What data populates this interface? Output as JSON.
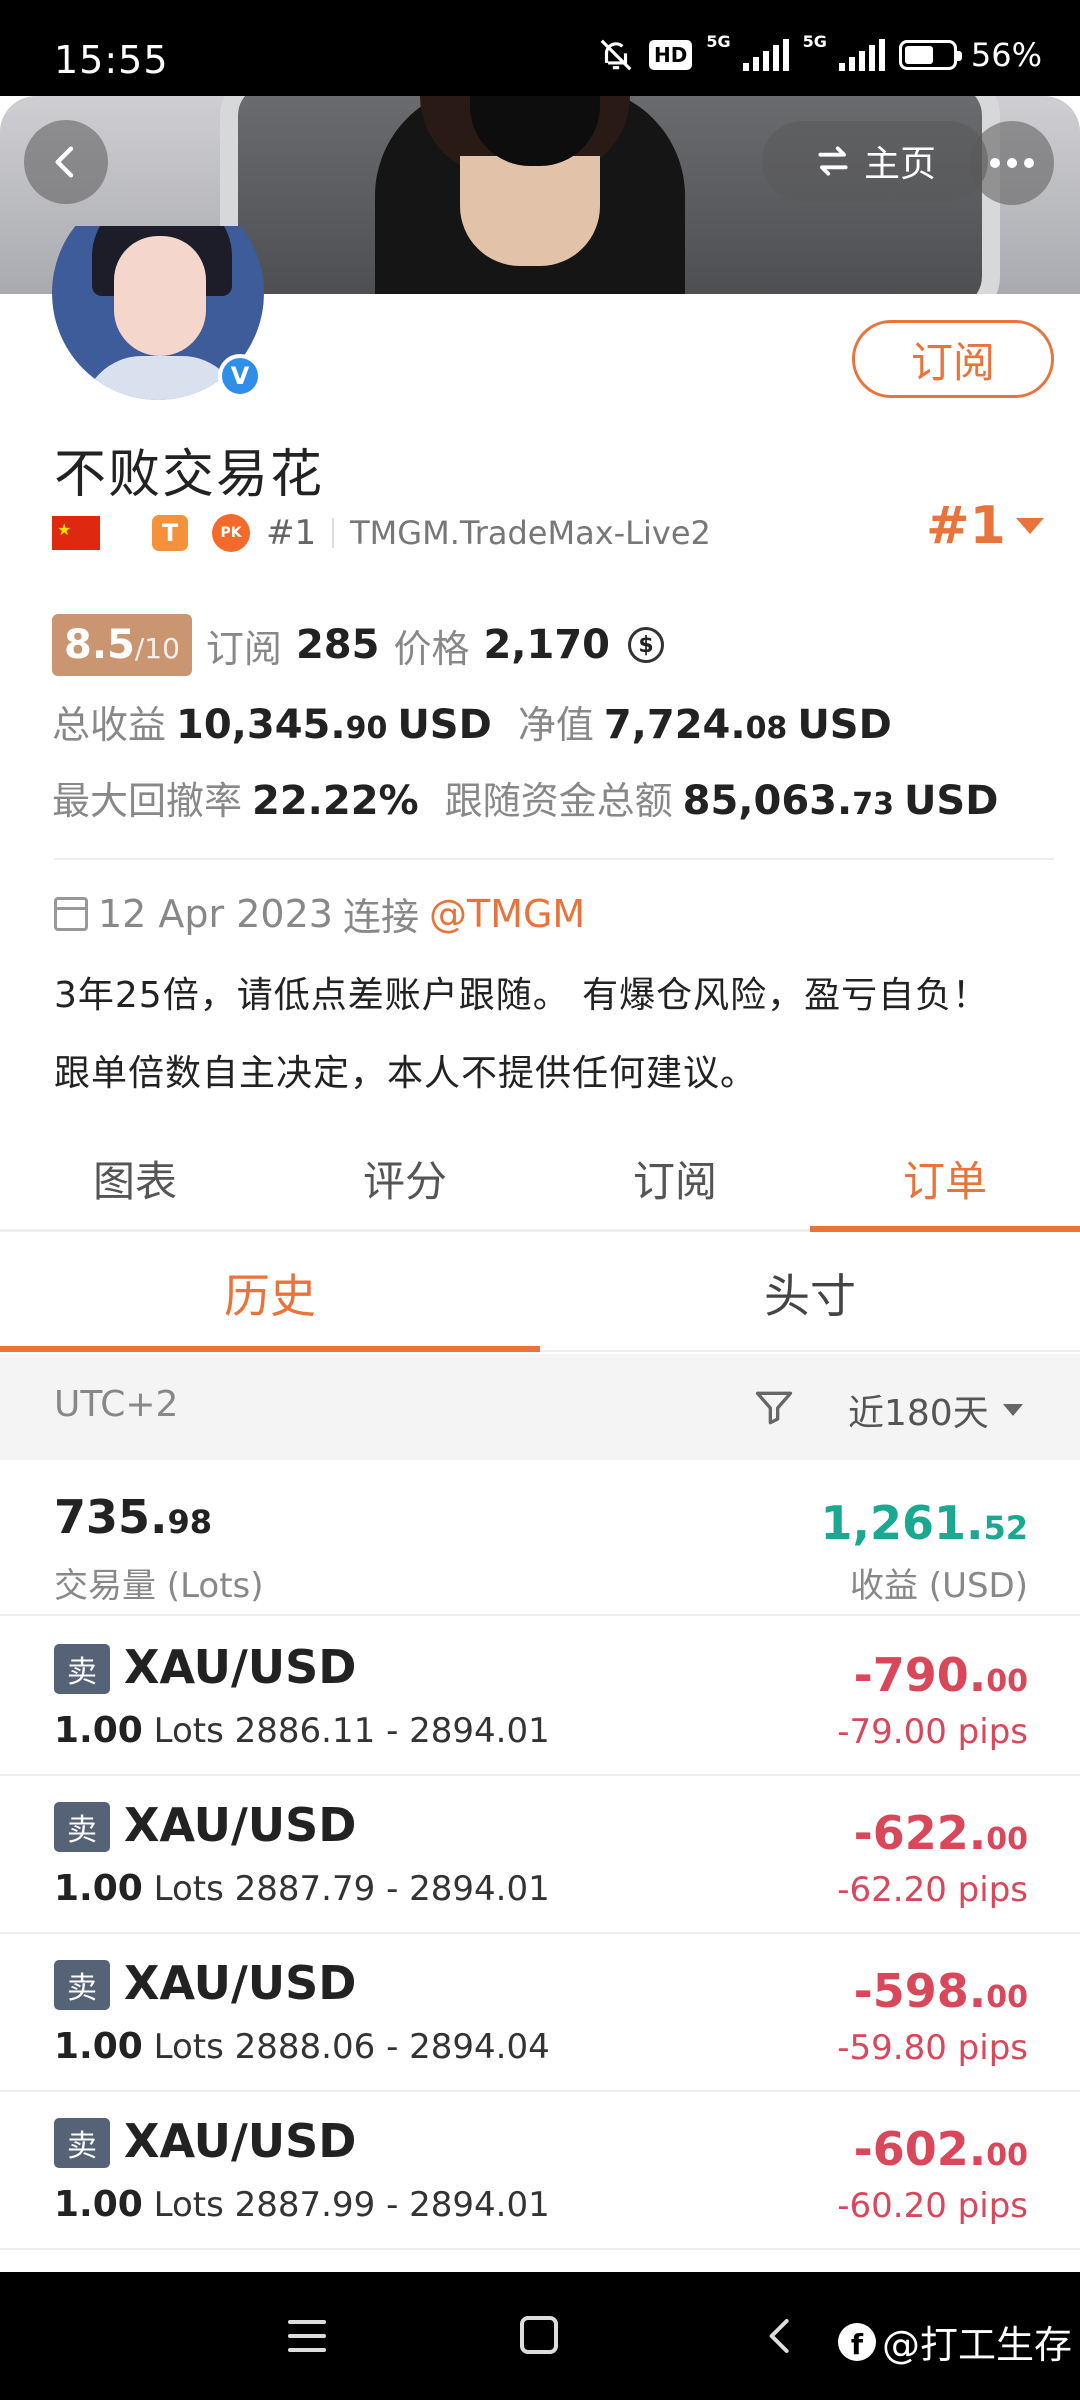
{
  "status_bar": {
    "time": "15:55",
    "hd": "HD",
    "net1": "5G",
    "net2": "5G",
    "battery": "56%"
  },
  "header": {
    "home_label": "主页"
  },
  "profile": {
    "name": "不败交易花",
    "subscribe_label": "订阅",
    "verified_mark": "V",
    "t_badge": "T",
    "pk_badge": "PK",
    "rank_small": "#1",
    "server": "TMGM.TradeMax-Live2",
    "rank_big": "#1"
  },
  "stats": {
    "score": "8.5",
    "score_max": "/10",
    "subscribers_label": "订阅",
    "subscribers": "285",
    "price_label": "价格",
    "price": "2,170",
    "coin": "$",
    "total_profit_label": "总收益",
    "total_profit_main": "10,345.",
    "total_profit_dec": "90",
    "total_profit_unit": "USD",
    "equity_label": "净值",
    "equity_main": "7,724.",
    "equity_dec": "08",
    "equity_unit": "USD",
    "drawdown_label": "最大回撤率",
    "drawdown": "22.22%",
    "follow_funds_label": "跟随资金总额",
    "follow_funds_main": "85,063.",
    "follow_funds_dec": "73",
    "follow_funds_unit": "USD"
  },
  "info": {
    "date": "12 Apr 2023",
    "connect_label": "连接",
    "broker": "@TMGM",
    "bio_line1": "3年25倍，请低点差账户跟随。 有爆仓风险，盈亏自负！",
    "bio_line2": "跟单倍数自主决定，本人不提供任何建议。"
  },
  "main_tabs": [
    "图表",
    "评分",
    "订阅",
    "订单"
  ],
  "sub_tabs": [
    "历史",
    "头寸"
  ],
  "filter": {
    "timezone": "UTC+2",
    "period": "近180天"
  },
  "summary": {
    "lots_main": "735.",
    "lots_dec": "98",
    "lots_label": "交易量 (Lots)",
    "profit_main": "1,261.",
    "profit_dec": "52",
    "profit_label": "收益 (USD)"
  },
  "orders": [
    {
      "side": "卖",
      "symbol": "XAU/USD",
      "lots": "1.00",
      "lots_unit": "Lots",
      "range": "2886.11 - 2894.01",
      "pl_main": "-790.",
      "pl_dec": "00",
      "pips": "-79.00 pips"
    },
    {
      "side": "卖",
      "symbol": "XAU/USD",
      "lots": "1.00",
      "lots_unit": "Lots",
      "range": "2887.79 - 2894.01",
      "pl_main": "-622.",
      "pl_dec": "00",
      "pips": "-62.20 pips"
    },
    {
      "side": "卖",
      "symbol": "XAU/USD",
      "lots": "1.00",
      "lots_unit": "Lots",
      "range": "2888.06 - 2894.04",
      "pl_main": "-598.",
      "pl_dec": "00",
      "pips": "-59.80 pips"
    },
    {
      "side": "卖",
      "symbol": "XAU/USD",
      "lots": "1.00",
      "lots_unit": "Lots",
      "range": "2887.99 - 2894.01",
      "pl_main": "-602.",
      "pl_dec": "00",
      "pips": "-60.20 pips"
    }
  ],
  "watermark": {
    "fb": "f",
    "text": "@打工生存"
  },
  "colors": {
    "accent": "#e8743b",
    "profit": "#1aa890",
    "loss": "#d9475a",
    "side_badge": "#566377",
    "score_badge": "#c99671"
  },
  "icons": [
    "bell-off-icon",
    "back-arrow-icon",
    "swap-icon",
    "more-icon",
    "calendar-icon",
    "filter-icon",
    "menu-icon",
    "home-square-icon",
    "nav-back-icon"
  ]
}
